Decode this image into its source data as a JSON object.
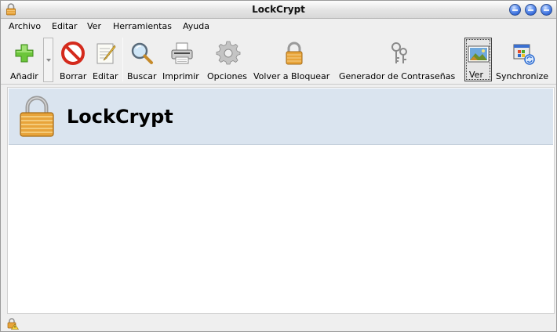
{
  "window": {
    "title": "LockCrypt"
  },
  "menu": {
    "archivo": "Archivo",
    "editar": "Editar",
    "ver": "Ver",
    "herramientas": "Herramientas",
    "ayuda": "Ayuda"
  },
  "toolbar": {
    "add": "Añadir",
    "delete": "Borrar",
    "edit": "Editar",
    "search": "Buscar",
    "print": "Imprimir",
    "options": "Opciones",
    "relock": "Volver a Bloquear",
    "password_generator": "Generador de Contraseñas",
    "view": "Ver",
    "synchronize": "Synchronize",
    "view_toggle_pressed": true
  },
  "banner": {
    "title": "LockCrypt"
  },
  "icons": {
    "title": "lock-icon",
    "add": "plus-icon",
    "delete": "no-entry-icon",
    "edit": "notepad-pencil-icon",
    "search": "magnifier-icon",
    "print": "printer-icon",
    "options": "gear-icon",
    "relock": "padlock-icon",
    "password_generator": "keys-icon",
    "view": "picture-icon",
    "synchronize": "sync-window-icon",
    "banner": "big-lock-icon",
    "status": "warning-lock-icon"
  },
  "colors": {
    "banner_bg": "#dae4ef",
    "window_bg": "#efefef",
    "window_buttons": "#2a5fd2",
    "add_green": "#6cc63b",
    "delete_red": "#d42a1c",
    "lock_gold": "#e8a43a"
  }
}
